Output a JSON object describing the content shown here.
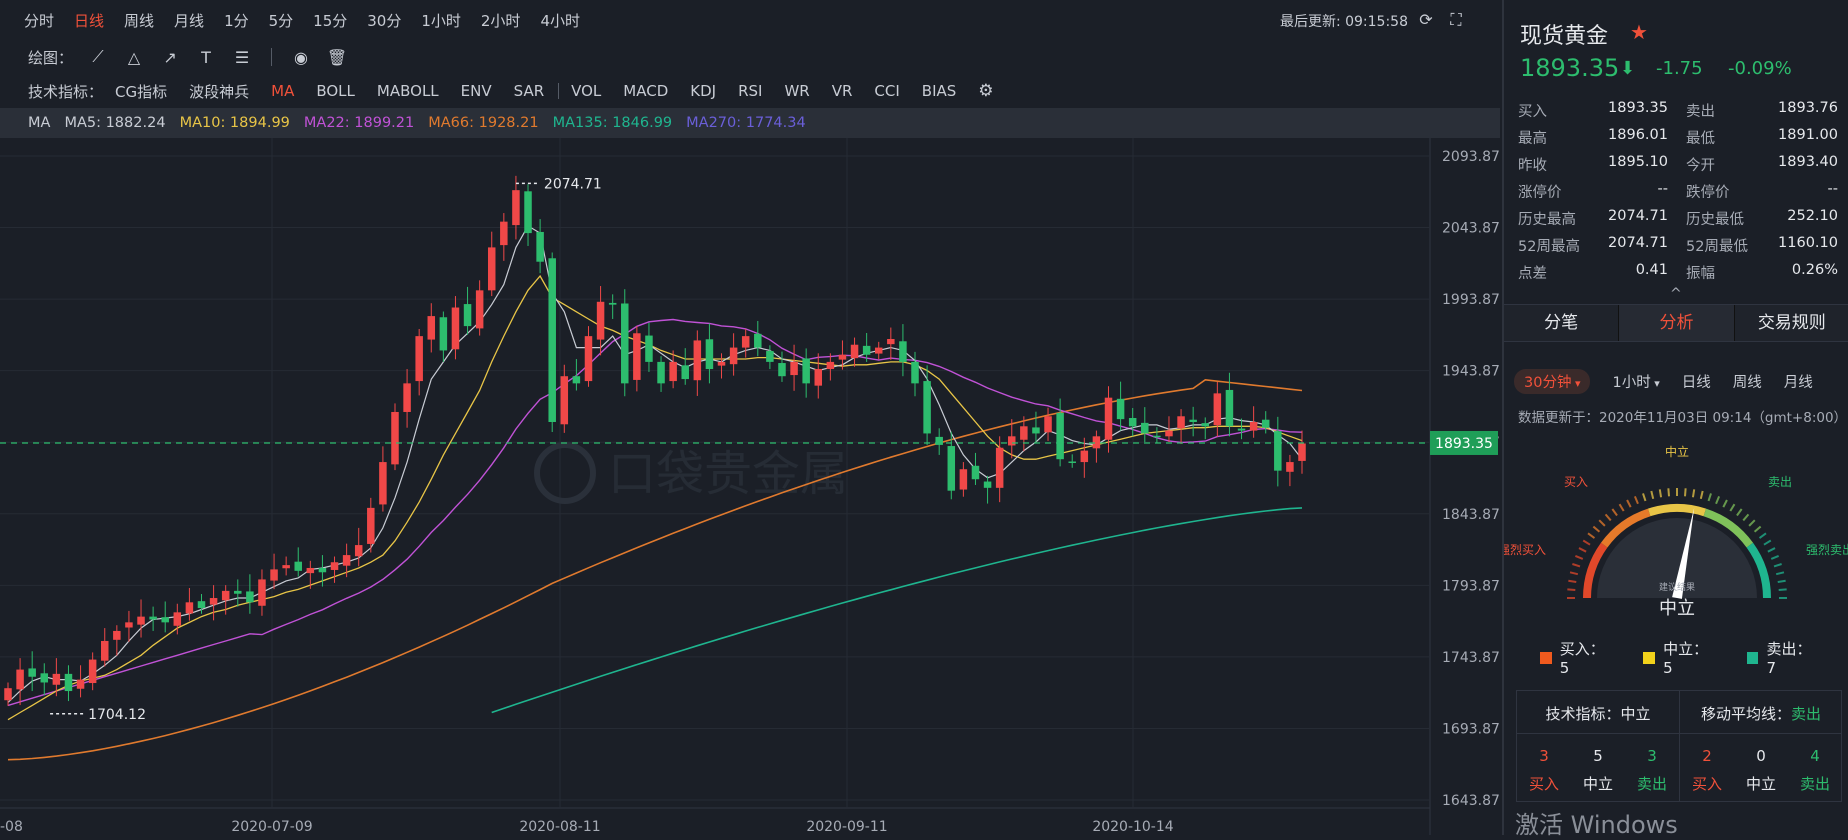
{
  "toolbar": {
    "timeframes": [
      "分时",
      "日线",
      "周线",
      "月线",
      "1分",
      "5分",
      "15分",
      "30分",
      "1小时",
      "2小时",
      "4小时"
    ],
    "active_timeframe": "日线",
    "last_update": "最后更新: 09:15:58",
    "draw_label": "绘图：",
    "indicator_label": "技术指标：",
    "indicators_main": [
      "CG指标",
      "波段神兵",
      "MA",
      "BOLL",
      "MABOLL",
      "ENV",
      "SAR"
    ],
    "indicators_sub": [
      "VOL",
      "MACD",
      "KDJ",
      "RSI",
      "WR",
      "VR",
      "CCI",
      "BIAS"
    ],
    "active_indicator": "MA"
  },
  "ma_bar": {
    "label": "MA",
    "items": [
      {
        "text": "MA5: 1882.24",
        "color": "#c8ccd4"
      },
      {
        "text": "MA10: 1894.99",
        "color": "#e8c547"
      },
      {
        "text": "MA22: 1899.21",
        "color": "#c052d6"
      },
      {
        "text": "MA66: 1928.21",
        "color": "#e07a2e"
      },
      {
        "text": "MA135: 1846.99",
        "color": "#1fb58f"
      },
      {
        "text": "MA270: 1774.34",
        "color": "#6a5fd8"
      }
    ]
  },
  "chart_data": {
    "type": "candlestick",
    "y_ticks": [
      2093.87,
      2043.87,
      1993.87,
      1943.87,
      1893.87,
      1843.87,
      1793.87,
      1743.87,
      1693.87,
      1643.87
    ],
    "ylim": [
      1643.87,
      2093.87
    ],
    "x_ticks": [
      "-08",
      "2020-07-09",
      "2020-08-11",
      "2020-09-11",
      "2020-10-14"
    ],
    "current_price": "1893.35",
    "high_label": "2074.71",
    "low_label": "1704.12",
    "up_color": "#f04848",
    "down_color": "#2dbd6e",
    "closes": [
      1722,
      1735,
      1730,
      1726,
      1732,
      1720,
      1728,
      1742,
      1755,
      1762,
      1768,
      1772,
      1770,
      1768,
      1775,
      1782,
      1778,
      1785,
      1790,
      1788,
      1782,
      1798,
      1805,
      1808,
      1804,
      1806,
      1803,
      1810,
      1815,
      1822,
      1848,
      1880,
      1915,
      1935,
      1968,
      1982,
      1958,
      1988,
      1975,
      2000,
      2030,
      2048,
      2070,
      2040,
      2020,
      1908,
      1940,
      1935,
      1968,
      1992,
      1990,
      1935,
      1970,
      1950,
      1935,
      1950,
      1938,
      1965,
      1945,
      1950,
      1960,
      1968,
      1960,
      1950,
      1940,
      1950,
      1935,
      1945,
      1950,
      1955,
      1962,
      1955,
      1960,
      1966,
      1950,
      1935,
      1900,
      1892,
      1860,
      1875,
      1868,
      1862,
      1890,
      1898,
      1905,
      1900,
      1912,
      1882,
      1880,
      1888,
      1898,
      1925,
      1910,
      1905,
      1900,
      1898,
      1902,
      1912,
      1908,
      1905,
      1928,
      1905,
      1902,
      1908,
      1904,
      1874,
      1880,
      1893
    ],
    "ma5": [
      1712,
      1720,
      1727,
      1730,
      1728,
      1728,
      1727,
      1732,
      1738,
      1745,
      1755,
      1764,
      1770,
      1771,
      1772,
      1774,
      1777,
      1780,
      1783,
      1785,
      1785,
      1789,
      1793,
      1797,
      1799,
      1805,
      1806,
      1808,
      1810,
      1813,
      1820,
      1834,
      1855,
      1880,
      1910,
      1938,
      1950,
      1962,
      1970,
      1978,
      1990,
      2004,
      2030,
      2045,
      2040,
      1998,
      1985,
      1960,
      1960,
      1960,
      1968,
      1955,
      1958,
      1962,
      1956,
      1950,
      1946,
      1950,
      1952,
      1950,
      1955,
      1958,
      1960,
      1958,
      1952,
      1950,
      1947,
      1944,
      1946,
      1948,
      1953,
      1956,
      1958,
      1960,
      1958,
      1951,
      1938,
      1920,
      1900,
      1885,
      1875,
      1869,
      1872,
      1880,
      1888,
      1894,
      1902,
      1899,
      1895,
      1893,
      1892,
      1897,
      1902,
      1904,
      1906,
      1906,
      1903,
      1904,
      1906,
      1906,
      1910,
      1911,
      1909,
      1908,
      1906,
      1899,
      1893,
      1882
    ],
    "ma10": [
      1700,
      1705,
      1710,
      1715,
      1720,
      1724,
      1727,
      1729,
      1731,
      1735,
      1740,
      1745,
      1752,
      1758,
      1764,
      1768,
      1772,
      1775,
      1777,
      1780,
      1782,
      1784,
      1786,
      1789,
      1791,
      1794,
      1797,
      1800,
      1803,
      1806,
      1810,
      1815,
      1825,
      1838,
      1852,
      1868,
      1885,
      1900,
      1915,
      1930,
      1950,
      1968,
      1985,
      2000,
      2010,
      1995,
      1990,
      1985,
      1980,
      1975,
      1972,
      1968,
      1965,
      1962,
      1958,
      1955,
      1952,
      1952,
      1952,
      1952,
      1952,
      1952,
      1953,
      1953,
      1952,
      1951,
      1950,
      1949,
      1948,
      1947,
      1948,
      1948,
      1949,
      1950,
      1950,
      1948,
      1944,
      1938,
      1928,
      1918,
      1908,
      1898,
      1890,
      1885,
      1882,
      1882,
      1884,
      1886,
      1888,
      1890,
      1892,
      1894,
      1896,
      1898,
      1900,
      1901,
      1902,
      1903,
      1904,
      1904,
      1905,
      1905,
      1905,
      1905,
      1904,
      1901,
      1898,
      1895
    ]
  },
  "quote": {
    "symbol": "现货黄金",
    "price": "1893.35",
    "change": "-1.75",
    "change_pct": "-0.09%",
    "rows": [
      [
        "买入",
        "1893.35",
        "卖出",
        "1893.76"
      ],
      [
        "最高",
        "1896.01",
        "最低",
        "1891.00"
      ],
      [
        "昨收",
        "1895.10",
        "今开",
        "1893.40"
      ],
      [
        "涨停价",
        "--",
        "跌停价",
        "--"
      ],
      [
        "历史最高",
        "2074.71",
        "历史最低",
        "252.10"
      ],
      [
        "52周最高",
        "2074.71",
        "52周最低",
        "1160.10"
      ],
      [
        "点差",
        "0.41",
        "振幅",
        "0.26%"
      ]
    ]
  },
  "tabs": [
    "分笔",
    "分析",
    "交易规则"
  ],
  "active_tab": "分析",
  "analysis": {
    "timeframes": [
      "30分钟",
      "1小时",
      "日线",
      "周线",
      "月线"
    ],
    "selected": "30分钟",
    "update_time": "数据更新于：2020年11月03日 09:14（gmt+8:00）",
    "gauge_labels": {
      "strong_buy": "强烈买入",
      "buy": "买入",
      "neutral": "中立",
      "sell": "卖出",
      "strong_sell": "强烈卖出",
      "center_small": "建议结果",
      "center_big": "中立"
    },
    "gauge_value": 0.56,
    "legend": [
      {
        "label": "买入：5",
        "color": "#f05a1e"
      },
      {
        "label": "中立：5",
        "color": "#f2d21b"
      },
      {
        "label": "卖出：7",
        "color": "#1fb58f"
      }
    ],
    "summary": [
      {
        "title": "技术指标：",
        "result": "中立",
        "result_color": "#e6e8ec",
        "counts": [
          "3",
          "5",
          "3"
        ],
        "labels": [
          "买入",
          "中立",
          "卖出"
        ]
      },
      {
        "title": "移动平均线：",
        "result": "卖出",
        "result_color": "#2dbd6e",
        "counts": [
          "2",
          "0",
          "4"
        ],
        "labels": [
          "买入",
          "中立",
          "卖出"
        ]
      }
    ]
  },
  "watermark": "激活 Windows"
}
